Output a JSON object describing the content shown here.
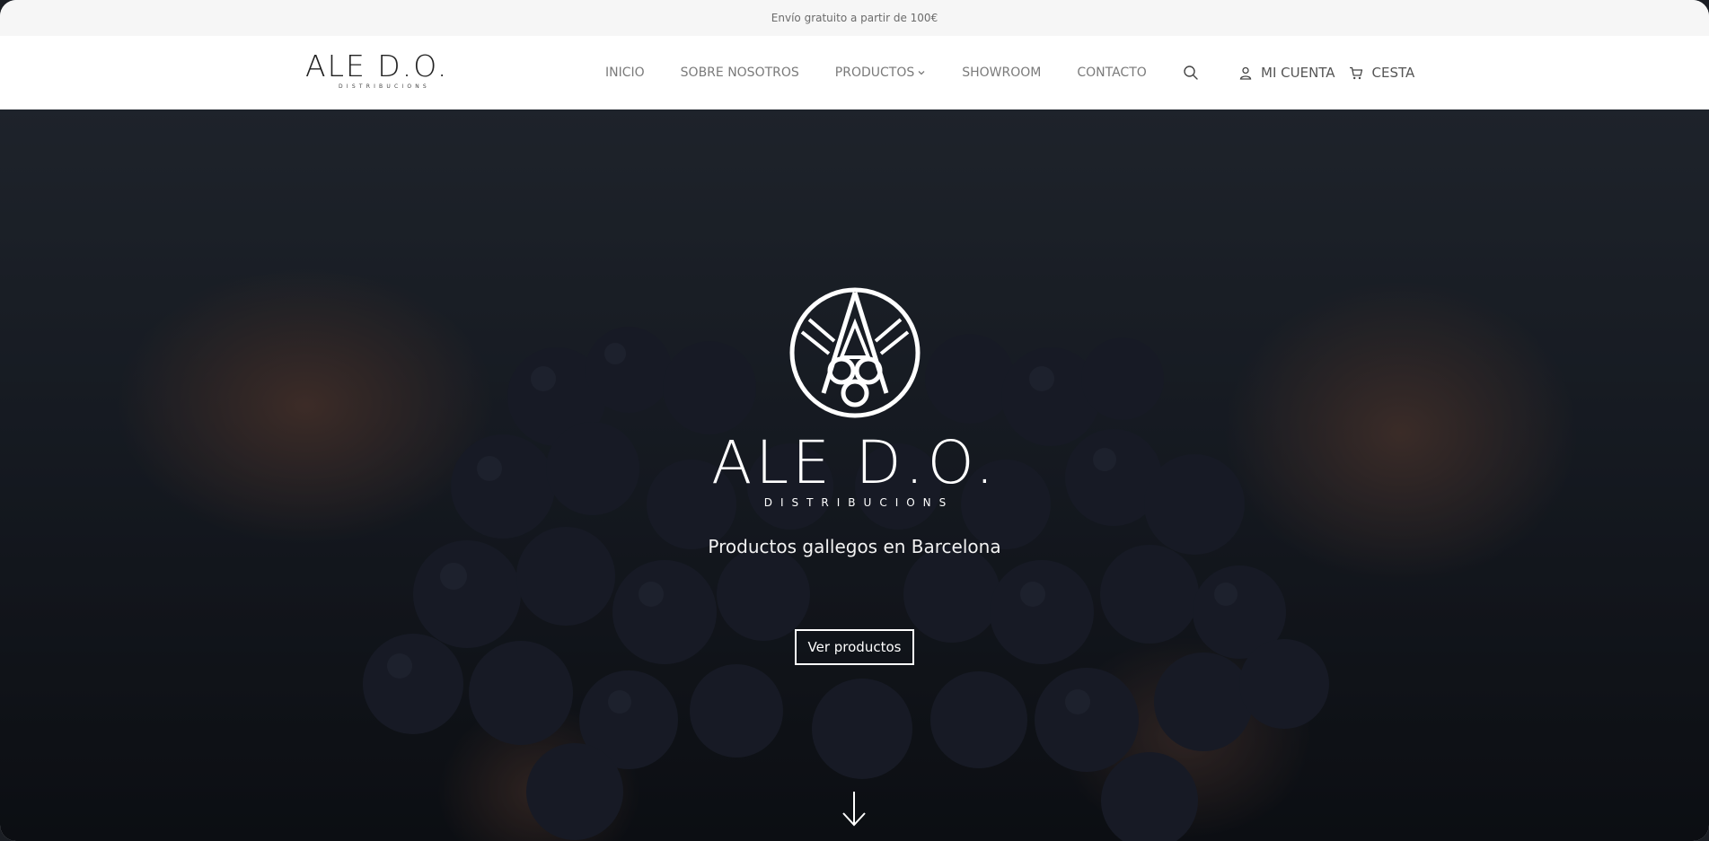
{
  "announcement": {
    "text": "Envío gratuito a partir de 100€"
  },
  "header": {
    "logo": {
      "main": "ALE D.O.",
      "sub": "DISTRIBUCIONS"
    },
    "nav": [
      {
        "label": "INICIO"
      },
      {
        "label": "SOBRE NOSOTROS"
      },
      {
        "label": "PRODUCTOS",
        "has_dropdown": true
      },
      {
        "label": "SHOWROOM"
      },
      {
        "label": "CONTACTO"
      }
    ],
    "search_icon": "search-icon",
    "account": {
      "label": "MI CUENTA",
      "icon": "user-icon"
    },
    "cart": {
      "label": "CESTA",
      "icon": "cart-icon"
    }
  },
  "hero": {
    "emblem_icon": "grape-emblem-icon",
    "brand_main": "ALE D.O.",
    "brand_sub": "DISTRIBUCIONS",
    "tagline": "Productos gallegos en Barcelona",
    "cta_label": "Ver productos",
    "scroll_icon": "arrow-down-icon"
  },
  "colors": {
    "topbar_bg": "#f6f6f6",
    "nav_text": "#7a7a7a",
    "hero_text": "#ffffff"
  }
}
